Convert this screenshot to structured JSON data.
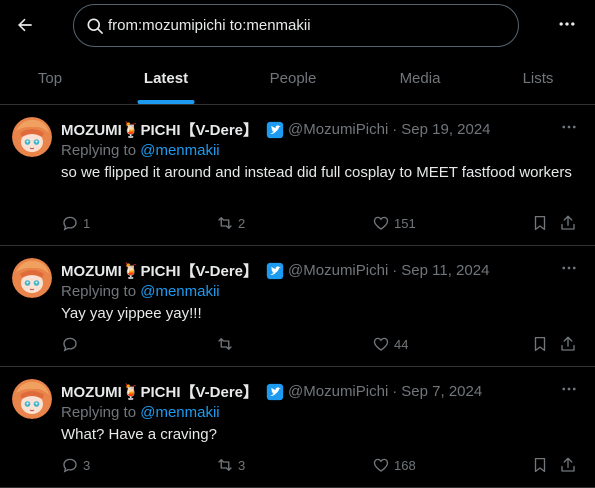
{
  "search": {
    "query": "from:mozumipichi to:menmakii"
  },
  "tabs": [
    {
      "label": "Top"
    },
    {
      "label": "Latest"
    },
    {
      "label": "People"
    },
    {
      "label": "Media"
    },
    {
      "label": "Lists"
    }
  ],
  "active_tab": "Latest",
  "colors": {
    "accent": "#1d9bf0",
    "muted": "#71767b",
    "text": "#e7e9ea",
    "border": "#2f3336"
  },
  "tweets": [
    {
      "name": "MOZUMI🍹PICHI【V-Dere】",
      "handle": "@MozumiPichi",
      "separator": "·",
      "date": "Sep 19, 2024",
      "replying_prefix": "Replying to",
      "replying_to": "@menmakii",
      "text": "so we flipped it around and instead did full cosplay to MEET fastfood workers",
      "replies": "1",
      "reposts": "2",
      "likes": "151"
    },
    {
      "name": "MOZUMI🍹PICHI【V-Dere】",
      "handle": "@MozumiPichi",
      "separator": "·",
      "date": "Sep 11, 2024",
      "replying_prefix": "Replying to",
      "replying_to": "@menmakii",
      "text": "Yay yay yippee yay!!!",
      "replies": "",
      "reposts": "",
      "likes": "44"
    },
    {
      "name": "MOZUMI🍹PICHI【V-Dere】",
      "handle": "@MozumiPichi",
      "separator": "·",
      "date": "Sep 7, 2024",
      "replying_prefix": "Replying to",
      "replying_to": "@menmakii",
      "text": "What? Have a craving?",
      "replies": "3",
      "reposts": "3",
      "likes": "168"
    }
  ]
}
